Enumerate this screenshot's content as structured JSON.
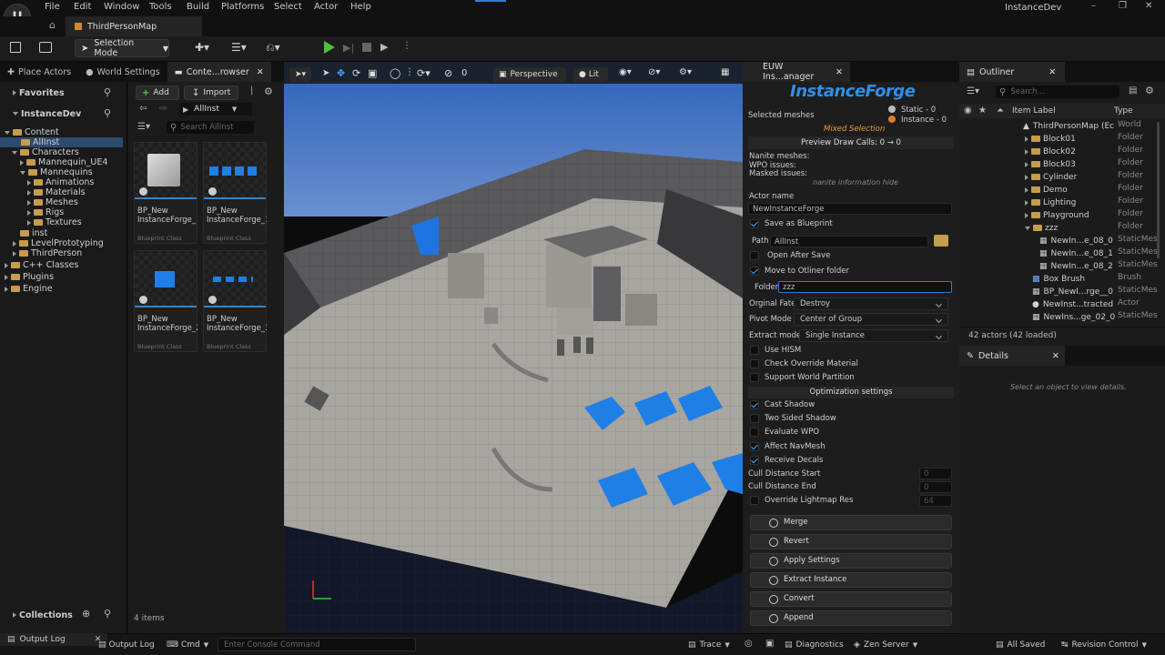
{
  "menu": [
    "File",
    "Edit",
    "Window",
    "Tools",
    "Build",
    "Platforms",
    "Select",
    "Actor",
    "Help"
  ],
  "project_name": "InstanceDev",
  "map_tab": "ThirdPersonMap",
  "toolbar": {
    "selection_mode": "Selection Mode"
  },
  "left_tabs": [
    "Place Actors",
    "World Settings",
    "Conte...rowser"
  ],
  "sources": {
    "favorites": "Favorites",
    "project": "InstanceDev",
    "collections": "Collections"
  },
  "tree": [
    {
      "label": "Content",
      "indent": 0,
      "open": true
    },
    {
      "label": "AllInst",
      "indent": 1,
      "selected": true
    },
    {
      "label": "Characters",
      "indent": 1,
      "open": true
    },
    {
      "label": "Mannequin_UE4",
      "indent": 2
    },
    {
      "label": "Mannequins",
      "indent": 2,
      "open": true
    },
    {
      "label": "Animations",
      "indent": 3
    },
    {
      "label": "Materials",
      "indent": 3
    },
    {
      "label": "Meshes",
      "indent": 3
    },
    {
      "label": "Rigs",
      "indent": 3
    },
    {
      "label": "Textures",
      "indent": 3
    },
    {
      "label": "inst",
      "indent": 1
    },
    {
      "label": "LevelPrototyping",
      "indent": 1
    },
    {
      "label": "ThirdPerson",
      "indent": 1
    },
    {
      "label": "C++ Classes",
      "indent": 0
    },
    {
      "label": "Plugins",
      "indent": 0
    },
    {
      "label": "Engine",
      "indent": 0
    }
  ],
  "browser": {
    "add": "Add",
    "import": "Import",
    "path": "AllInst",
    "search_placeholder": "Search AllInst",
    "item_count": "4 items"
  },
  "assets": [
    {
      "name": "BP_New InstanceForge_",
      "class": "Blueprint Class"
    },
    {
      "name": "BP_New InstanceForge_1",
      "class": "Blueprint Class"
    },
    {
      "name": "BP_New InstanceForge_2",
      "class": "Blueprint Class"
    },
    {
      "name": "BP_New InstanceForge_3",
      "class": "Blueprint Class"
    }
  ],
  "viewport": {
    "perspective": "Perspective",
    "lit": "Lit",
    "speed": "0"
  },
  "euw": {
    "tab": "EUW Ins...anager",
    "logo": "InstanceForge",
    "selected_meshes": "Selected meshes",
    "static_count": "Static - 0",
    "instance_count": "Instance - 0",
    "mixed": "Mixed Selection",
    "preview": "Preview Draw Calls: 0 → 0",
    "nanite_meshes": "Nanite meshes:",
    "wpo": "WPO issues:",
    "masked": "Masked issues:",
    "nanite_hide": "nanite information hide",
    "actor_name_label": "Actor name",
    "actor_name": "NewInstanceForge",
    "save_bp": "Save as Blueprint",
    "path_label": "Path",
    "path": "AllInst",
    "open_after": "Open After Save",
    "move_outliner": "Move to Otliner folder",
    "folder_label": "Folder",
    "folder": "zzz",
    "orig_fate_label": "Orginal Fate",
    "orig_fate": "Destroy",
    "pivot_label": "Pivot Mode",
    "pivot": "Center of Group",
    "extract_label": "Extract mode",
    "extract": "Single Instance",
    "use_hism": "Use HISM",
    "check_override": "Check Override Material",
    "world_partition": "Support World Partition",
    "opt_settings": "Optimization settings",
    "cast_shadow": "Cast Shadow",
    "two_sided": "Two Sided Shadow",
    "eval_wpo": "Evaluate WPO",
    "navmesh": "Affect NavMesh",
    "decals": "Receive Decals",
    "cull_start": "Cull Distance Start",
    "cull_start_v": "0",
    "cull_end": "Cull Distance End",
    "cull_end_v": "0",
    "lightmap": "Override Lightmap Res",
    "lightmap_v": "64",
    "buttons": [
      "Merge",
      "Revert",
      "Apply Settings",
      "Extract Instance",
      "Convert",
      "Append"
    ]
  },
  "outliner": {
    "tab": "Outliner",
    "search_placeholder": "Search...",
    "col_label": "Item Label",
    "col_type": "Type",
    "rows": [
      {
        "label": "ThirdPersonMap (Ec",
        "type": "World",
        "indent": 0
      },
      {
        "label": "Block01",
        "type": "Folder",
        "indent": 1
      },
      {
        "label": "Block02",
        "type": "Folder",
        "indent": 1
      },
      {
        "label": "Block03",
        "type": "Folder",
        "indent": 1
      },
      {
        "label": "Cylinder",
        "type": "Folder",
        "indent": 1
      },
      {
        "label": "Demo",
        "type": "Folder",
        "indent": 1
      },
      {
        "label": "Lighting",
        "type": "Folder",
        "indent": 1
      },
      {
        "label": "Playground",
        "type": "Folder",
        "indent": 1
      },
      {
        "label": "zzz",
        "type": "Folder",
        "indent": 1
      },
      {
        "label": "NewIn...e_08_0",
        "type": "StaticMes",
        "indent": 2
      },
      {
        "label": "NewIn...e_08_1",
        "type": "StaticMes",
        "indent": 2
      },
      {
        "label": "NewIn...e_08_2",
        "type": "StaticMes",
        "indent": 2
      },
      {
        "label": "Box Brush",
        "type": "Brush",
        "indent": 1
      },
      {
        "label": "BP_NewI...rge__0",
        "type": "StaticMes",
        "indent": 1
      },
      {
        "label": "NewInst...tracted",
        "type": "Actor",
        "indent": 1
      },
      {
        "label": "NewIns...ge_02_0",
        "type": "StaticMes",
        "indent": 1
      }
    ],
    "count": "42 actors (42 loaded)"
  },
  "details": {
    "tab": "Details",
    "empty": "Select an object to view details."
  },
  "status": {
    "output_log": "Output Log",
    "output_log2": "Output Log",
    "cmd": "Cmd",
    "console_placeholder": "Enter Console Command",
    "trace": "Trace",
    "diagnostics": "Diagnostics",
    "zen": "Zen Server",
    "saved": "All Saved",
    "revision": "Revision Control"
  }
}
